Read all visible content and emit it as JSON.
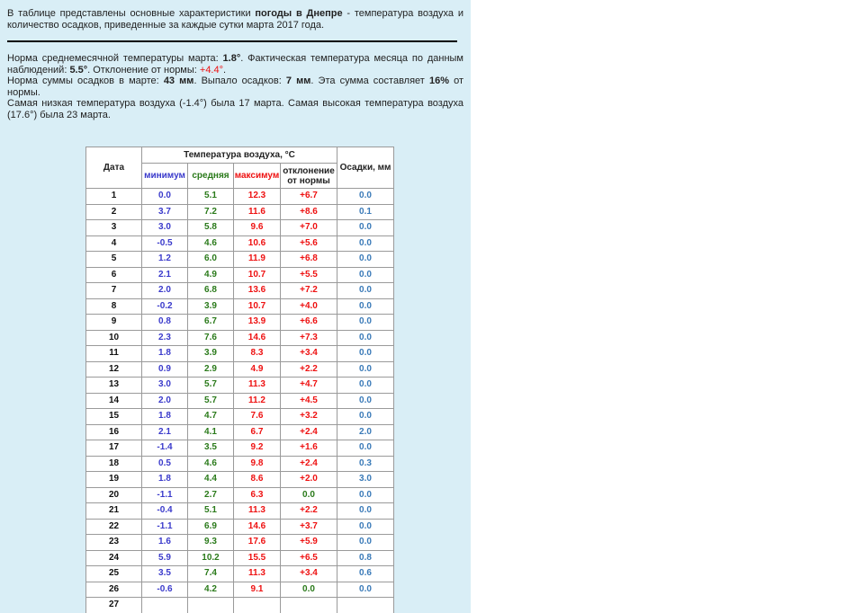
{
  "intro": {
    "before": "В таблице представлены основные характеристики ",
    "bold": "погоды в Днепре",
    "after": " - температура воздуха и количество осадков, приведенные за каждые сутки марта 2017 года."
  },
  "summary": {
    "temp_norm_label": "Норма среднемесячной температуры марта: ",
    "temp_norm": "1.8°",
    "temp_actual_label": ". Фактическая температура месяца по данным наблюдений: ",
    "temp_actual": "5.5°",
    "deviation_label": ". Отклонение от нормы: ",
    "deviation": "+4.4°",
    "deviation_end": ".",
    "precip_norm_label": "Норма суммы осадков в марте: ",
    "precip_norm": "43 мм",
    "precip_actual_label": ". Выпало осадков: ",
    "precip_actual": "7 мм",
    "precip_pct_label": ". Эта сумма составляет ",
    "precip_pct": "16%",
    "precip_pct_end": " от нормы.",
    "extremes": "Самая низкая температура воздуха (-1.4°) была 17 марта. Самая высокая температура воздуха (17.6°) была 23 марта."
  },
  "table": {
    "headers": {
      "date": "Дата",
      "temp_group": "Температура воздуха, °С",
      "min": "минимум",
      "avg": "средняя",
      "max": "максимум",
      "deviation": "отклонение от нормы",
      "precip": "Осадки, мм"
    },
    "rows": [
      {
        "day": "1",
        "min": "0.0",
        "avg": "5.1",
        "max": "12.3",
        "dev": "+6.7",
        "prc": "0.0"
      },
      {
        "day": "2",
        "min": "3.7",
        "avg": "7.2",
        "max": "11.6",
        "dev": "+8.6",
        "prc": "0.1"
      },
      {
        "day": "3",
        "min": "3.0",
        "avg": "5.8",
        "max": "9.6",
        "dev": "+7.0",
        "prc": "0.0"
      },
      {
        "day": "4",
        "min": "-0.5",
        "avg": "4.6",
        "max": "10.6",
        "dev": "+5.6",
        "prc": "0.0"
      },
      {
        "day": "5",
        "min": "1.2",
        "avg": "6.0",
        "max": "11.9",
        "dev": "+6.8",
        "prc": "0.0"
      },
      {
        "day": "6",
        "min": "2.1",
        "avg": "4.9",
        "max": "10.7",
        "dev": "+5.5",
        "prc": "0.0"
      },
      {
        "day": "7",
        "min": "2.0",
        "avg": "6.8",
        "max": "13.6",
        "dev": "+7.2",
        "prc": "0.0"
      },
      {
        "day": "8",
        "min": "-0.2",
        "avg": "3.9",
        "max": "10.7",
        "dev": "+4.0",
        "prc": "0.0"
      },
      {
        "day": "9",
        "min": "0.8",
        "avg": "6.7",
        "max": "13.9",
        "dev": "+6.6",
        "prc": "0.0"
      },
      {
        "day": "10",
        "min": "2.3",
        "avg": "7.6",
        "max": "14.6",
        "dev": "+7.3",
        "prc": "0.0"
      },
      {
        "day": "11",
        "min": "1.8",
        "avg": "3.9",
        "max": "8.3",
        "dev": "+3.4",
        "prc": "0.0"
      },
      {
        "day": "12",
        "min": "0.9",
        "avg": "2.9",
        "max": "4.9",
        "dev": "+2.2",
        "prc": "0.0"
      },
      {
        "day": "13",
        "min": "3.0",
        "avg": "5.7",
        "max": "11.3",
        "dev": "+4.7",
        "prc": "0.0"
      },
      {
        "day": "14",
        "min": "2.0",
        "avg": "5.7",
        "max": "11.2",
        "dev": "+4.5",
        "prc": "0.0"
      },
      {
        "day": "15",
        "min": "1.8",
        "avg": "4.7",
        "max": "7.6",
        "dev": "+3.2",
        "prc": "0.0"
      },
      {
        "day": "16",
        "min": "2.1",
        "avg": "4.1",
        "max": "6.7",
        "dev": "+2.4",
        "prc": "2.0"
      },
      {
        "day": "17",
        "min": "-1.4",
        "avg": "3.5",
        "max": "9.2",
        "dev": "+1.6",
        "prc": "0.0"
      },
      {
        "day": "18",
        "min": "0.5",
        "avg": "4.6",
        "max": "9.8",
        "dev": "+2.4",
        "prc": "0.3"
      },
      {
        "day": "19",
        "min": "1.8",
        "avg": "4.4",
        "max": "8.6",
        "dev": "+2.0",
        "prc": "3.0"
      },
      {
        "day": "20",
        "min": "-1.1",
        "avg": "2.7",
        "max": "6.3",
        "dev": "0.0",
        "prc": "0.0"
      },
      {
        "day": "21",
        "min": "-0.4",
        "avg": "5.1",
        "max": "11.3",
        "dev": "+2.2",
        "prc": "0.0"
      },
      {
        "day": "22",
        "min": "-1.1",
        "avg": "6.9",
        "max": "14.6",
        "dev": "+3.7",
        "prc": "0.0"
      },
      {
        "day": "23",
        "min": "1.6",
        "avg": "9.3",
        "max": "17.6",
        "dev": "+5.9",
        "prc": "0.0"
      },
      {
        "day": "24",
        "min": "5.9",
        "avg": "10.2",
        "max": "15.5",
        "dev": "+6.5",
        "prc": "0.8"
      },
      {
        "day": "25",
        "min": "3.5",
        "avg": "7.4",
        "max": "11.3",
        "dev": "+3.4",
        "prc": "0.6"
      },
      {
        "day": "26",
        "min": "-0.6",
        "avg": "4.2",
        "max": "9.1",
        "dev": "0.0",
        "prc": "0.0"
      },
      {
        "day": "27",
        "min": "",
        "avg": "",
        "max": "",
        "dev": "",
        "prc": ""
      }
    ]
  },
  "colors": {
    "panel_bg": "#d9eef6",
    "min": "#3a3acb",
    "avg": "#2a7a1a",
    "max": "#ee1111",
    "precip": "#3a7ab8"
  }
}
